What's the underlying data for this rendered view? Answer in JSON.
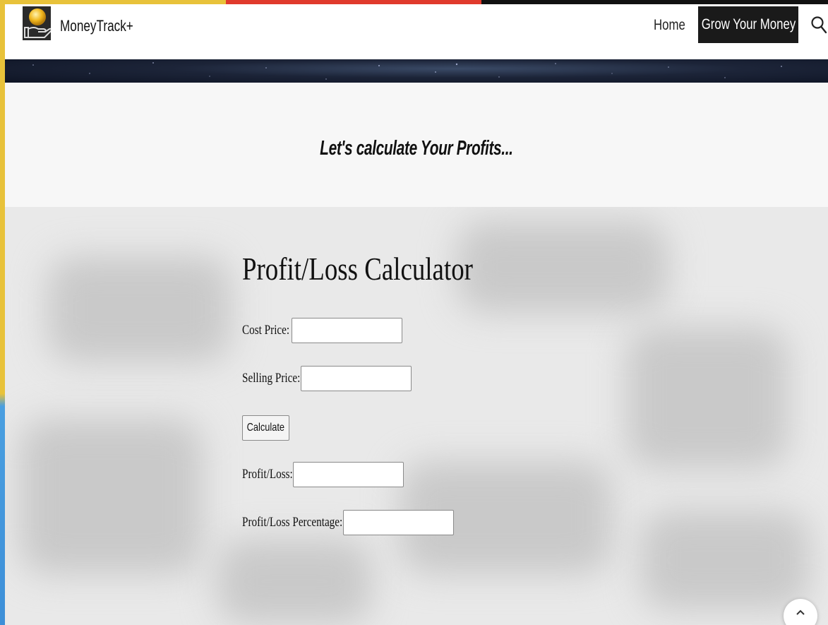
{
  "header": {
    "brand": "MoneyTrack+",
    "nav": [
      {
        "label": "Home"
      },
      {
        "label": "Grow Your Money"
      }
    ]
  },
  "intro": {
    "title": "Let's calculate Your  Profits..."
  },
  "calculator": {
    "title": "Profit/Loss Calculator",
    "cost_price": {
      "label": "Cost Price:",
      "value": ""
    },
    "selling_price": {
      "label": "Selling Price:",
      "value": ""
    },
    "calculate_label": "Calculate",
    "profit_loss": {
      "label": "Profit/Loss:",
      "value": ""
    },
    "profit_loss_percentage": {
      "label": "Profit/Loss Percentage:",
      "value": ""
    }
  },
  "colors": {
    "accent_yellow": "#e8c23a",
    "accent_red": "#e03a2c",
    "accent_blue": "#3d8fd8",
    "nav_active_bg": "#1a1a1a"
  },
  "icons": [
    "money-hand-logo-icon",
    "search-icon",
    "chevron-up-icon"
  ]
}
